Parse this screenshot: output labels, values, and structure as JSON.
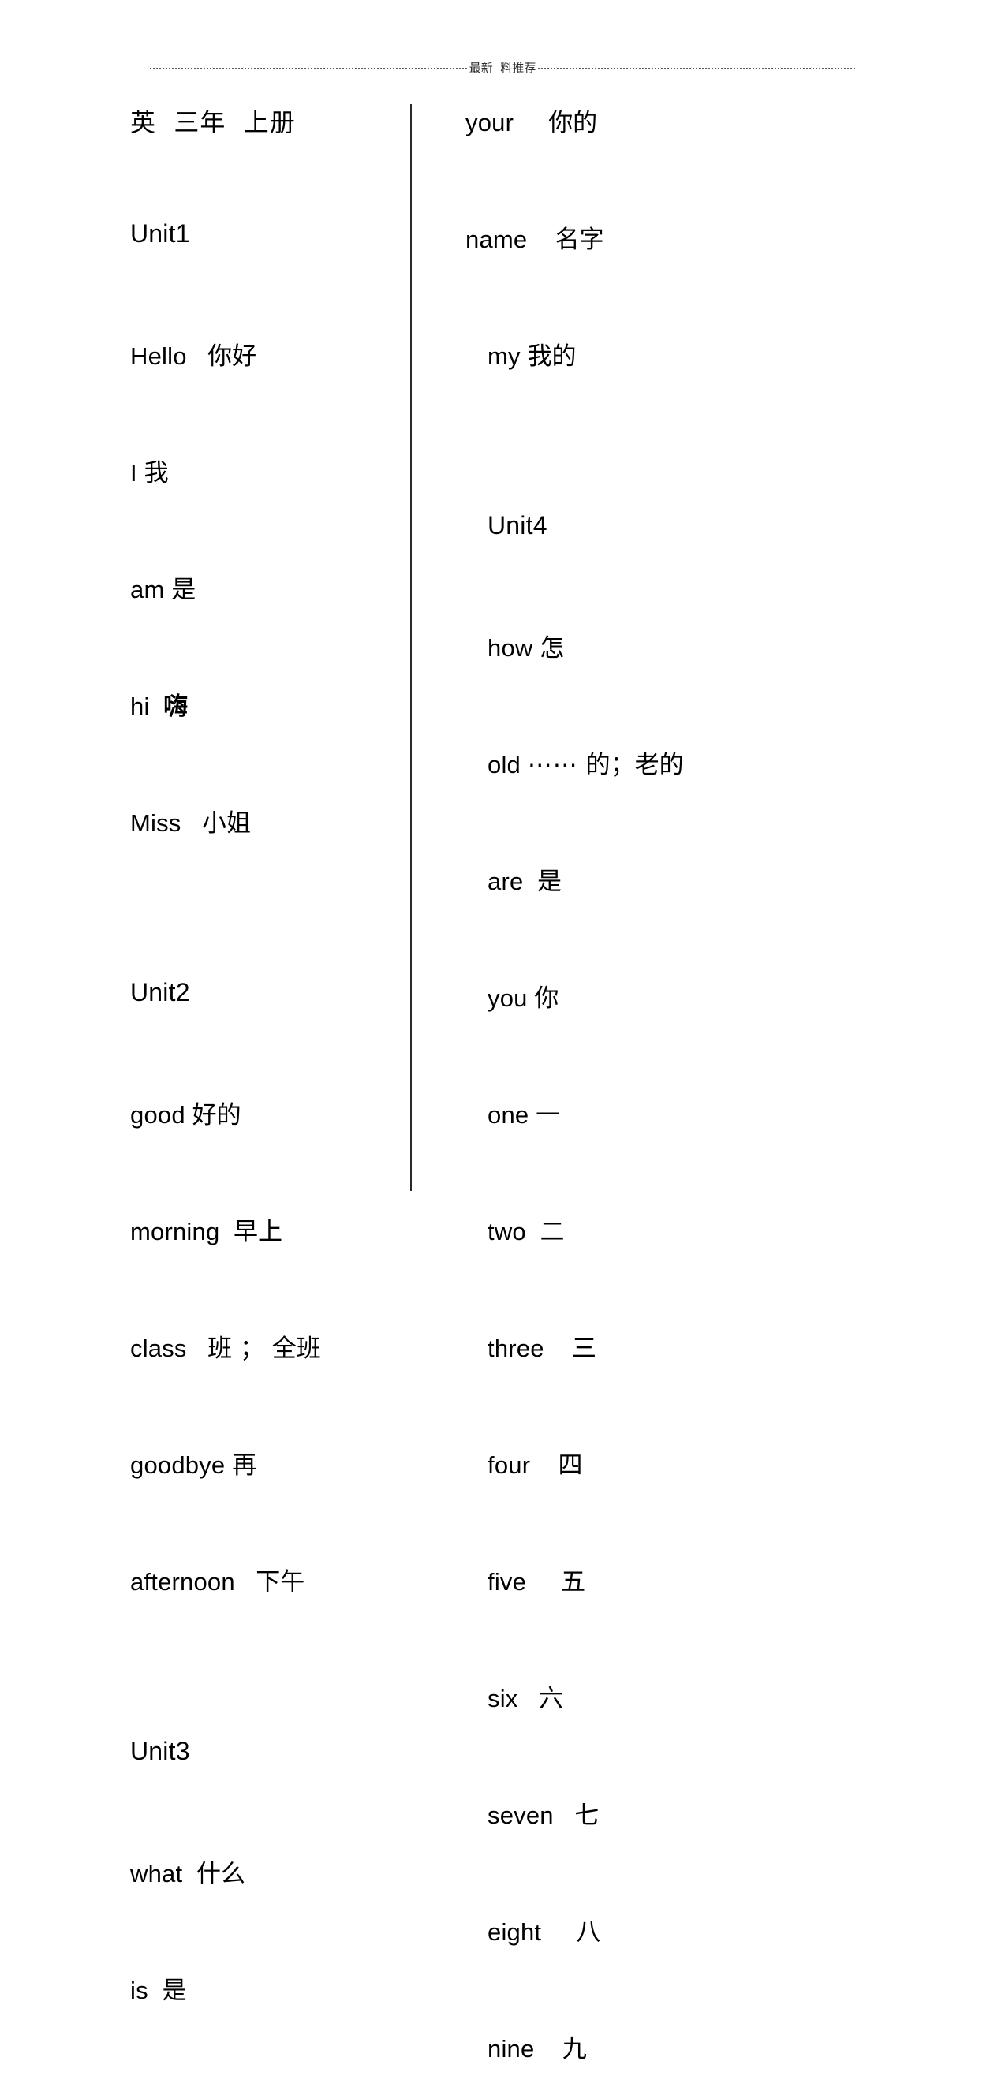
{
  "header": {
    "watermark_text": "最新  料推荐"
  },
  "document": {
    "title": "英  三年  上册"
  },
  "left_column": [
    {
      "type": "title",
      "cn": "英  三年  上册"
    },
    {
      "type": "blank"
    },
    {
      "type": "unit",
      "en": "Unit1"
    },
    {
      "type": "blank"
    },
    {
      "type": "word",
      "en": "Hello",
      "gap": "   ",
      "cn": "你好"
    },
    {
      "type": "blank"
    },
    {
      "type": "word",
      "en": "I",
      "gap": " ",
      "cn": "我"
    },
    {
      "type": "blank"
    },
    {
      "type": "word",
      "en": "am",
      "gap": " ",
      "cn": "是"
    },
    {
      "type": "blank"
    },
    {
      "type": "word",
      "en": "hi",
      "gap": "  ",
      "cn": "嗨",
      "bold": true
    },
    {
      "type": "blank"
    },
    {
      "type": "word",
      "en": "Miss",
      "gap": "   ",
      "cn": "小姐"
    },
    {
      "type": "blank"
    },
    {
      "type": "blank"
    },
    {
      "type": "unit",
      "en": "Unit2"
    },
    {
      "type": "blank"
    },
    {
      "type": "word",
      "en": "good",
      "gap": " ",
      "cn": "好的"
    },
    {
      "type": "blank"
    },
    {
      "type": "word",
      "en": "morning",
      "gap": "  ",
      "cn": "早上"
    },
    {
      "type": "blank"
    },
    {
      "type": "word",
      "en": "class",
      "gap": "   ",
      "cn": "班 ； 全班"
    },
    {
      "type": "blank"
    },
    {
      "type": "word",
      "en": "goodbye",
      "gap": " ",
      "cn": "再"
    },
    {
      "type": "blank"
    },
    {
      "type": "word",
      "en": "afternoon",
      "gap": "   ",
      "cn": "下午"
    },
    {
      "type": "blank"
    },
    {
      "type": "blank"
    },
    {
      "type": "unit",
      "en": "Unit3"
    },
    {
      "type": "blank"
    },
    {
      "type": "word",
      "en": "what",
      "gap": "  ",
      "cn": "什么"
    },
    {
      "type": "blank"
    },
    {
      "type": "word",
      "en": "is",
      "gap": "  ",
      "cn": "是"
    }
  ],
  "right_column": [
    {
      "type": "word",
      "en": "your",
      "gap": "     ",
      "cn": "你的"
    },
    {
      "type": "blank"
    },
    {
      "type": "word",
      "en": "name",
      "gap": "    ",
      "cn": "名字"
    },
    {
      "type": "blank"
    },
    {
      "type": "word",
      "en": "my",
      "gap": " ",
      "cn": "我的",
      "indent": true
    },
    {
      "type": "blank"
    },
    {
      "type": "blank"
    },
    {
      "type": "unit",
      "en": "Unit4",
      "indent": true
    },
    {
      "type": "blank"
    },
    {
      "type": "word",
      "en": "how",
      "gap": " ",
      "cn": "怎",
      "indent": true
    },
    {
      "type": "blank"
    },
    {
      "type": "word",
      "en": "old",
      "gap": " ",
      "dots": "⋯⋯",
      "cn": " 的；老的",
      "indent": true
    },
    {
      "type": "blank"
    },
    {
      "type": "word",
      "en": "are",
      "gap": "  ",
      "cn": "是",
      "indent": true
    },
    {
      "type": "blank"
    },
    {
      "type": "word",
      "en": "you",
      "gap": " ",
      "cn": "你",
      "indent": true
    },
    {
      "type": "blank"
    },
    {
      "type": "word",
      "en": "one",
      "gap": " ",
      "cn": "一",
      "indent": true
    },
    {
      "type": "blank"
    },
    {
      "type": "word",
      "en": "two",
      "gap": "  ",
      "cn": "二",
      "indent": true
    },
    {
      "type": "blank"
    },
    {
      "type": "word",
      "en": "three",
      "gap": "    ",
      "cn": "三",
      "indent": true
    },
    {
      "type": "blank"
    },
    {
      "type": "word",
      "en": "four",
      "gap": "    ",
      "cn": "四",
      "indent": true
    },
    {
      "type": "blank"
    },
    {
      "type": "word",
      "en": "five",
      "gap": "     ",
      "cn": "五",
      "indent": true
    },
    {
      "type": "blank"
    },
    {
      "type": "word",
      "en": "six",
      "gap": "   ",
      "cn": "六",
      "indent": true
    },
    {
      "type": "blank"
    },
    {
      "type": "word",
      "en": "seven",
      "gap": "   ",
      "cn": "七",
      "indent": true
    },
    {
      "type": "blank"
    },
    {
      "type": "word",
      "en": "eight",
      "gap": "     ",
      "cn": "八",
      "indent": true
    },
    {
      "type": "blank"
    },
    {
      "type": "word",
      "en": "nine",
      "gap": "    ",
      "cn": "九",
      "indent": true
    }
  ]
}
